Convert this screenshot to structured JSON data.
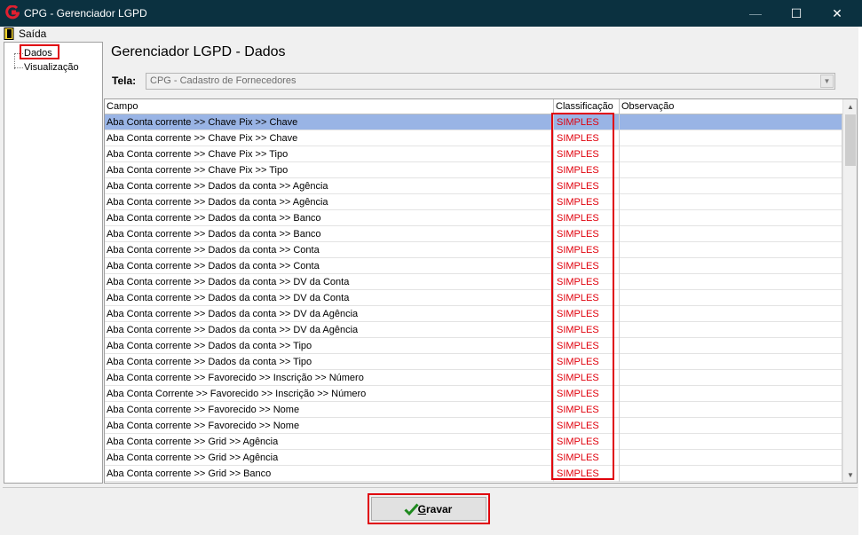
{
  "window": {
    "title": "CPG - Gerenciador LGPD",
    "minimize_glyph": "—",
    "maximize_glyph": "☐",
    "close_glyph": "✕"
  },
  "menu": {
    "exit_label": "Saída"
  },
  "tree": {
    "items": [
      "Dados",
      "Visualização"
    ]
  },
  "page_title": "Gerenciador LGPD - Dados",
  "tela": {
    "label": "Tela:",
    "value": "CPG - Cadastro de Fornecedores",
    "arrow_glyph": "▼"
  },
  "grid": {
    "columns": [
      "Campo",
      "Classificação",
      "Observação"
    ],
    "rows": [
      {
        "campo": "Aba Conta corrente >> Chave Pix >> Chave",
        "classificacao": "SIMPLES",
        "observacao": "",
        "selected": true
      },
      {
        "campo": "Aba Conta corrente >> Chave Pix >> Chave",
        "classificacao": "SIMPLES",
        "observacao": ""
      },
      {
        "campo": "Aba Conta corrente >> Chave Pix >> Tipo",
        "classificacao": "SIMPLES",
        "observacao": ""
      },
      {
        "campo": "Aba Conta corrente >> Chave Pix >> Tipo",
        "classificacao": "SIMPLES",
        "observacao": ""
      },
      {
        "campo": "Aba Conta corrente >> Dados da conta >> Agência",
        "classificacao": "SIMPLES",
        "observacao": ""
      },
      {
        "campo": "Aba Conta corrente >> Dados da conta >> Agência",
        "classificacao": "SIMPLES",
        "observacao": ""
      },
      {
        "campo": "Aba Conta corrente >> Dados da conta >> Banco",
        "classificacao": "SIMPLES",
        "observacao": ""
      },
      {
        "campo": "Aba Conta corrente >> Dados da conta >> Banco",
        "classificacao": "SIMPLES",
        "observacao": ""
      },
      {
        "campo": "Aba Conta corrente >> Dados da conta >> Conta",
        "classificacao": "SIMPLES",
        "observacao": ""
      },
      {
        "campo": "Aba Conta corrente >> Dados da conta >> Conta",
        "classificacao": "SIMPLES",
        "observacao": ""
      },
      {
        "campo": "Aba Conta corrente >> Dados da conta >> DV da  Conta",
        "classificacao": "SIMPLES",
        "observacao": ""
      },
      {
        "campo": "Aba Conta corrente >> Dados da conta >> DV da  Conta",
        "classificacao": "SIMPLES",
        "observacao": ""
      },
      {
        "campo": "Aba Conta corrente >> Dados da conta >> DV da Agência",
        "classificacao": "SIMPLES",
        "observacao": ""
      },
      {
        "campo": "Aba Conta corrente >> Dados da conta >> DV da Agência",
        "classificacao": "SIMPLES",
        "observacao": ""
      },
      {
        "campo": "Aba Conta corrente >> Dados da conta >> Tipo",
        "classificacao": "SIMPLES",
        "observacao": ""
      },
      {
        "campo": "Aba Conta corrente >> Dados da conta >> Tipo",
        "classificacao": "SIMPLES",
        "observacao": ""
      },
      {
        "campo": "Aba Conta corrente >> Favorecido >> Inscrição >> Número",
        "classificacao": "SIMPLES",
        "observacao": ""
      },
      {
        "campo": "Aba Conta Corrente >> Favorecido >> Inscrição >> Número",
        "classificacao": "SIMPLES",
        "observacao": ""
      },
      {
        "campo": "Aba Conta corrente >> Favorecido >> Nome",
        "classificacao": "SIMPLES",
        "observacao": ""
      },
      {
        "campo": "Aba Conta corrente >> Favorecido >> Nome",
        "classificacao": "SIMPLES",
        "observacao": ""
      },
      {
        "campo": "Aba Conta corrente >> Grid >> Agência",
        "classificacao": "SIMPLES",
        "observacao": ""
      },
      {
        "campo": "Aba Conta corrente >> Grid >> Agência",
        "classificacao": "SIMPLES",
        "observacao": ""
      },
      {
        "campo": "Aba Conta corrente >> Grid >> Banco",
        "classificacao": "SIMPLES",
        "observacao": ""
      }
    ],
    "scroll_up_glyph": "▲",
    "scroll_down_glyph": "▼"
  },
  "save_button": {
    "underlined_letter": "G",
    "label_rest": "ravar"
  },
  "colors": {
    "titlebar": "#0b3140",
    "highlight_box": "#e0000c",
    "classification_text": "#e0000c",
    "selected_row": "#99b4e5"
  }
}
